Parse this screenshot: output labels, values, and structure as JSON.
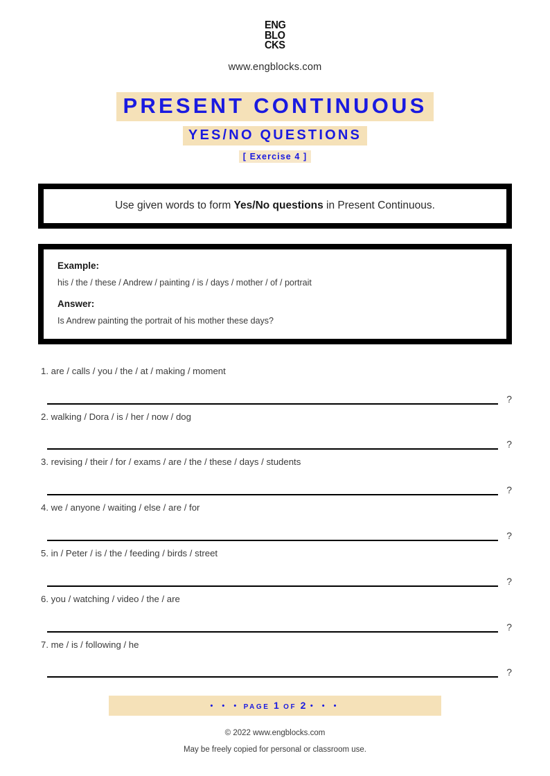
{
  "header": {
    "logo_lines": [
      "ENG",
      "BLO",
      "CKS"
    ],
    "site_url": "www.engblocks.com"
  },
  "titles": {
    "main": "PRESENT CONTINUOUS",
    "sub": "YES/NO QUESTIONS",
    "exercise": "[ Exercise 4 ]"
  },
  "instruction": {
    "before_bold": "Use given words to form ",
    "bold": "Yes/No questions",
    "after_bold": " in Present Continuous."
  },
  "example": {
    "example_label": "Example:",
    "example_words": "his / the / these / Andrew / painting / is / days / mother / of / portrait",
    "answer_label": "Answer:",
    "answer_text": "Is Andrew painting the portrait of his mother these days?"
  },
  "exercises": [
    {
      "number": "1.",
      "words": "are / calls / you / the / at / making / moment",
      "qmark": "?"
    },
    {
      "number": "2.",
      "words": "walking / Dora / is / her / now / dog",
      "qmark": "?"
    },
    {
      "number": "3.",
      "words": "revising / their / for / exams / are / the / these / days / students",
      "qmark": "?"
    },
    {
      "number": "4.",
      "words": "we / anyone / waiting / else / are / for",
      "qmark": "?"
    },
    {
      "number": "5.",
      "words": "in / Peter / is / the / feeding / birds / street",
      "qmark": "?"
    },
    {
      "number": "6.",
      "words": "you / watching / video / the / are",
      "qmark": "?"
    },
    {
      "number": "7.",
      "words": "me / is / following / he",
      "qmark": "?"
    }
  ],
  "footer": {
    "dots_left": "• • •",
    "page_word": "PAGE",
    "page_number": "1",
    "of_word": "OF",
    "total_pages": "2",
    "dots_right": "• • •",
    "copyright_line1": "© 2022 www.engblocks.com",
    "copyright_line2": "May be freely copied for personal or classroom use."
  },
  "colors": {
    "highlight": "#f5e1b8",
    "accent_blue": "#1a1ae0",
    "frame_black": "#000000",
    "body_text": "#3a3a3a"
  }
}
